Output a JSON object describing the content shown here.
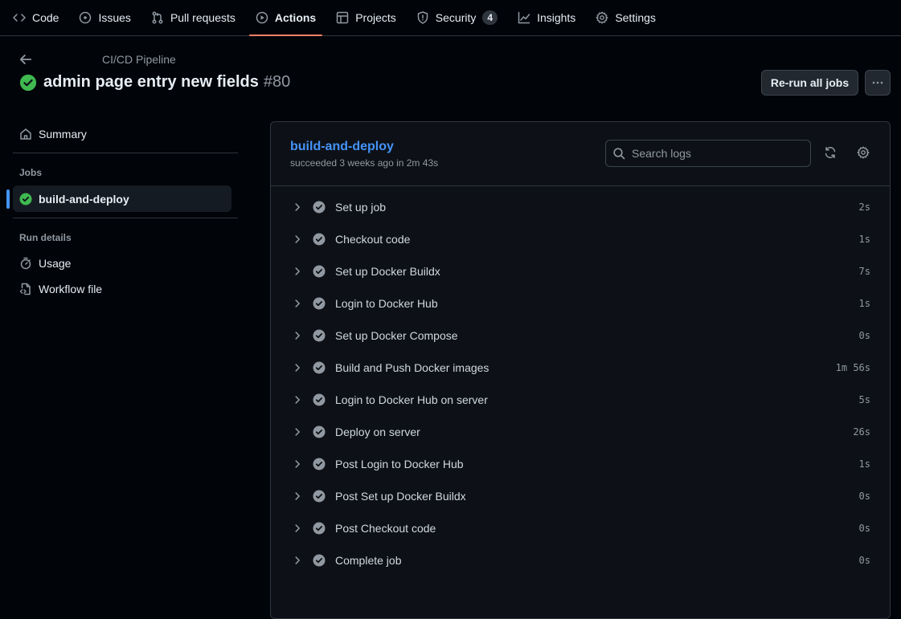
{
  "repo_nav": {
    "tabs": [
      {
        "label": "Code",
        "icon": "code-icon"
      },
      {
        "label": "Issues",
        "icon": "issue-opened-icon"
      },
      {
        "label": "Pull requests",
        "icon": "git-pull-request-icon"
      },
      {
        "label": "Actions",
        "icon": "play-icon",
        "active": true
      },
      {
        "label": "Projects",
        "icon": "table-icon"
      },
      {
        "label": "Security",
        "icon": "shield-icon",
        "counter": "4"
      },
      {
        "label": "Insights",
        "icon": "graph-icon"
      },
      {
        "label": "Settings",
        "icon": "gear-icon"
      }
    ]
  },
  "header": {
    "workflow_name": "CI/CD Pipeline",
    "run_title": "admin page entry new fields",
    "run_number": "#80",
    "rerun_label": "Re-run all jobs",
    "more_label": "···"
  },
  "sidebar": {
    "summary_label": "Summary",
    "jobs_heading": "Jobs",
    "job_label": "build-and-deploy",
    "run_details_heading": "Run details",
    "usage_label": "Usage",
    "workflow_file_label": "Workflow file"
  },
  "job": {
    "title": "build-and-deploy",
    "meta": "succeeded 3 weeks ago in 2m 43s",
    "search_placeholder": "Search logs",
    "steps": [
      {
        "name": "Set up job",
        "duration": "2s"
      },
      {
        "name": "Checkout code",
        "duration": "1s"
      },
      {
        "name": "Set up Docker Buildx",
        "duration": "7s"
      },
      {
        "name": "Login to Docker Hub",
        "duration": "1s"
      },
      {
        "name": "Set up Docker Compose",
        "duration": "0s"
      },
      {
        "name": "Build and Push Docker images",
        "duration": "1m 56s"
      },
      {
        "name": "Login to Docker Hub on server",
        "duration": "5s"
      },
      {
        "name": "Deploy on server",
        "duration": "26s"
      },
      {
        "name": "Post Login to Docker Hub",
        "duration": "1s"
      },
      {
        "name": "Post Set up Docker Buildx",
        "duration": "0s"
      },
      {
        "name": "Post Checkout code",
        "duration": "0s"
      },
      {
        "name": "Complete job",
        "duration": "0s"
      }
    ]
  },
  "colors": {
    "success": "#3fb950",
    "step_check": "#9198a1",
    "link": "#4493f8",
    "active_tab_underline": "#f78166"
  }
}
